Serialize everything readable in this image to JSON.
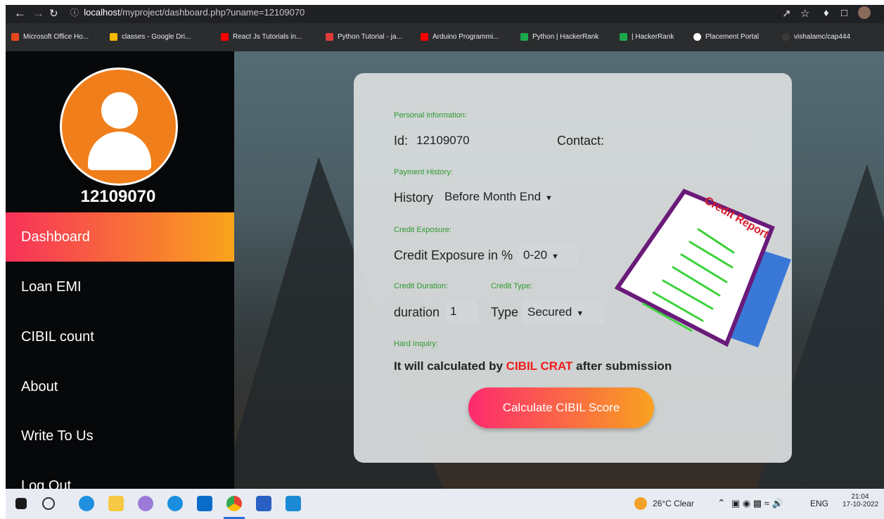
{
  "browser": {
    "url_host": "localhost",
    "url_path": "/myproject/dashboard.php?uname=12109070",
    "bookmarks": [
      {
        "label": "Microsoft Office Ho...",
        "color": "#e8481c"
      },
      {
        "label": "classes - Google Dri...",
        "color": "#f7b900"
      },
      {
        "label": "React Js Tutorials in...",
        "color": "#ff0000"
      },
      {
        "label": "Python Tutorial - ja...",
        "color": "#e03a3a"
      },
      {
        "label": "Arduino Programmi...",
        "color": "#ff0000"
      },
      {
        "label": "Python | HackerRank",
        "color": "#1ba94c"
      },
      {
        "label": "| HackerRank",
        "color": "#1ba94c"
      },
      {
        "label": "Placement Portal",
        "color": "#ffffff"
      },
      {
        "label": "vishalamc/cap444",
        "color": "#3a3a3a"
      }
    ]
  },
  "sidebar": {
    "username": "12109070",
    "items": [
      {
        "label": "Dashboard",
        "active": true
      },
      {
        "label": "Loan EMI"
      },
      {
        "label": "CIBIL count"
      },
      {
        "label": "About"
      },
      {
        "label": "Write To Us"
      },
      {
        "label": "Log Out"
      }
    ]
  },
  "form": {
    "personal_section": "Personal information:",
    "id_label": "Id:",
    "id_value": "12109070",
    "contact_label": "Contact:",
    "contact_value": "",
    "payment_section": "Payment History:",
    "history_label": "History",
    "history_value": "Before Month End",
    "exposure_section": "Credit Exposure:",
    "exposure_label": "Credit Exposure in %",
    "exposure_value": "0-20",
    "duration_section": "Credit Duration:",
    "type_section": "Credit Type:",
    "duration_label": "duration",
    "duration_value": "1",
    "type_label": "Type",
    "type_value": "Secured",
    "inquiry_section": "Hard Inquiry:",
    "note_prefix": "It will calculated by",
    "note_highlight": "CIBIL CRAT",
    "note_suffix": "after submission",
    "submit_label": "Calculate CIBIL Score",
    "report_title": "Credit Report"
  },
  "taskbar": {
    "weather": "26°C  Clear",
    "language": "ENG",
    "time": "21:04",
    "date": "17-10-2022"
  }
}
